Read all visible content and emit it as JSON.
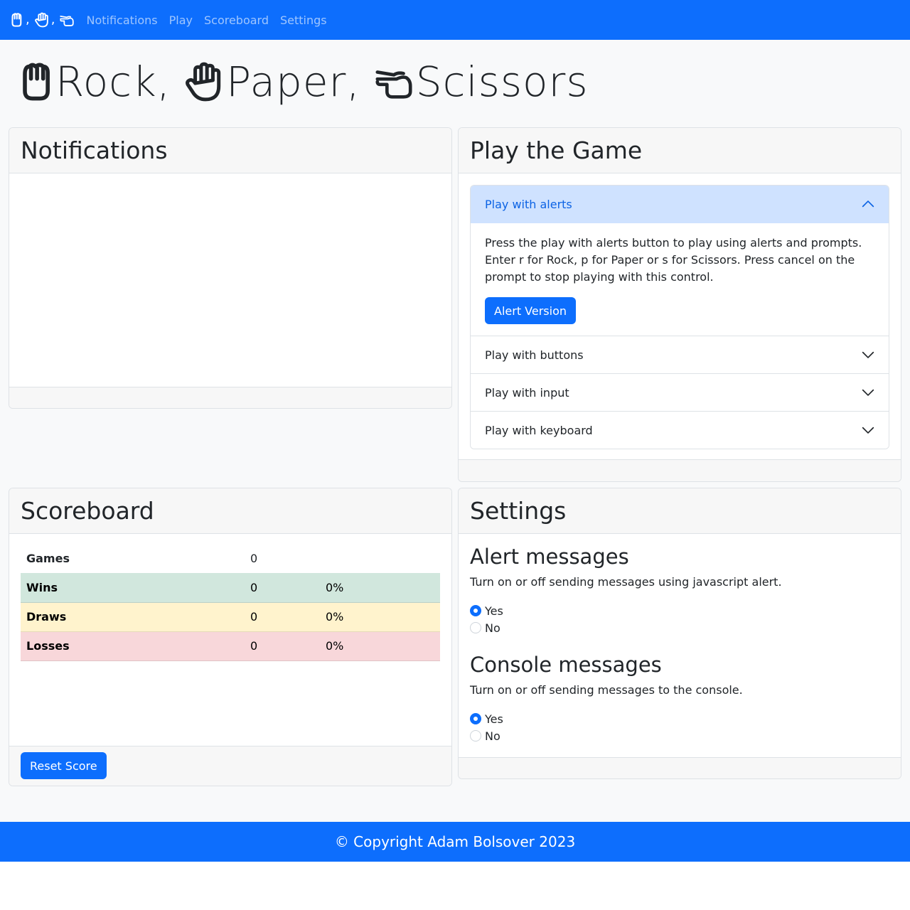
{
  "navbar": {
    "brand_separator": ",",
    "links": [
      "Notifications",
      "Play",
      "Scoreboard",
      "Settings"
    ]
  },
  "title": {
    "words": [
      "Rock,",
      "Paper,",
      "Scissors"
    ]
  },
  "notifications": {
    "header": "Notifications"
  },
  "play": {
    "header": "Play the Game",
    "sections": [
      {
        "label": "Play with alerts",
        "expanded": true
      },
      {
        "label": "Play with buttons",
        "expanded": false
      },
      {
        "label": "Play with input",
        "expanded": false
      },
      {
        "label": "Play with keyboard",
        "expanded": false
      }
    ],
    "alerts_body": "Press the play with alerts button to play using alerts and prompts. Enter r for Rock, p for Paper or s for Scissors. Press cancel on the prompt to stop playing with this control.",
    "alert_button": "Alert Version"
  },
  "scoreboard": {
    "header": "Scoreboard",
    "rows": [
      {
        "label": "Games",
        "count": "0",
        "percent": ""
      },
      {
        "label": "Wins",
        "count": "0",
        "percent": "0%"
      },
      {
        "label": "Draws",
        "count": "0",
        "percent": "0%"
      },
      {
        "label": "Losses",
        "count": "0",
        "percent": "0%"
      }
    ],
    "reset_button": "Reset Score"
  },
  "settings": {
    "header": "Settings",
    "groups": [
      {
        "title": "Alert messages",
        "description": "Turn on or off sending messages using javascript alert.",
        "options": [
          "Yes",
          "No"
        ],
        "selected": "Yes"
      },
      {
        "title": "Console messages",
        "description": "Turn on or off sending messages to the console.",
        "options": [
          "Yes",
          "No"
        ],
        "selected": "Yes"
      }
    ]
  },
  "footer": {
    "text": "© Copyright Adam Bolsover 2023"
  },
  "colors": {
    "primary": "#0d6efd",
    "page_bg": "#f8f9fa",
    "accordion_active_bg": "#cfe2ff",
    "win_bg": "#d1e7dd",
    "draw_bg": "#fff3cd",
    "loss_bg": "#f8d7da"
  },
  "icons": {
    "rock": "hand-rock-icon",
    "paper": "hand-paper-icon",
    "scissors": "hand-scissors-icon"
  }
}
